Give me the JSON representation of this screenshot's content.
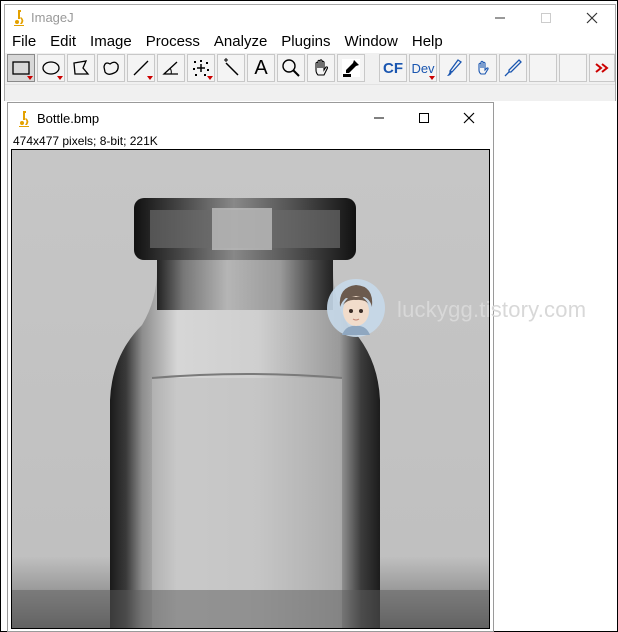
{
  "main_window": {
    "title": "ImageJ",
    "controls": {
      "minimize": "minimize-icon",
      "maximize": "maximize-icon",
      "close": "close-icon"
    }
  },
  "menu": [
    "File",
    "Edit",
    "Image",
    "Process",
    "Analyze",
    "Plugins",
    "Window",
    "Help"
  ],
  "toolbar": {
    "tools": [
      {
        "name": "rectangle-tool",
        "icon": "rectangle-icon",
        "selected": true
      },
      {
        "name": "oval-tool",
        "icon": "oval-icon"
      },
      {
        "name": "polygon-tool",
        "icon": "polygon-icon"
      },
      {
        "name": "freehand-tool",
        "icon": "freehand-icon"
      },
      {
        "name": "line-tool",
        "icon": "line-icon"
      },
      {
        "name": "angle-tool",
        "icon": "angle-icon"
      },
      {
        "name": "point-tool",
        "icon": "point-icon"
      },
      {
        "name": "wand-tool",
        "icon": "wand-icon"
      },
      {
        "name": "text-tool",
        "icon": "text-icon"
      },
      {
        "name": "magnifier-tool",
        "icon": "magnifier-icon"
      },
      {
        "name": "hand-tool",
        "icon": "hand-icon"
      },
      {
        "name": "dropper-tool",
        "icon": "dropper-icon"
      },
      {
        "name": "cf-tool",
        "icon": "cf-icon"
      },
      {
        "name": "dev-tool",
        "icon": "dev-icon"
      },
      {
        "name": "brush-tool",
        "icon": "brush-icon"
      },
      {
        "name": "flood-tool",
        "icon": "flood-fill-icon"
      },
      {
        "name": "pencil-tool",
        "icon": "pencil-icon"
      },
      {
        "name": "more-tools",
        "icon": "more-tools-icon"
      }
    ],
    "labels": {
      "text": "A",
      "cf": "CF",
      "dev": "Dev"
    }
  },
  "image_window": {
    "title": "Bottle.bmp",
    "info": "474x477 pixels; 8-bit; 221K",
    "controls": {
      "minimize": "minimize-icon",
      "maximize": "maximize-icon",
      "close": "close-icon"
    }
  },
  "watermark": "luckygg.tistory.com",
  "colors": {
    "accent_red": "#cc0000",
    "cf_blue": "#1a56b0",
    "title_gray": "#999999"
  }
}
